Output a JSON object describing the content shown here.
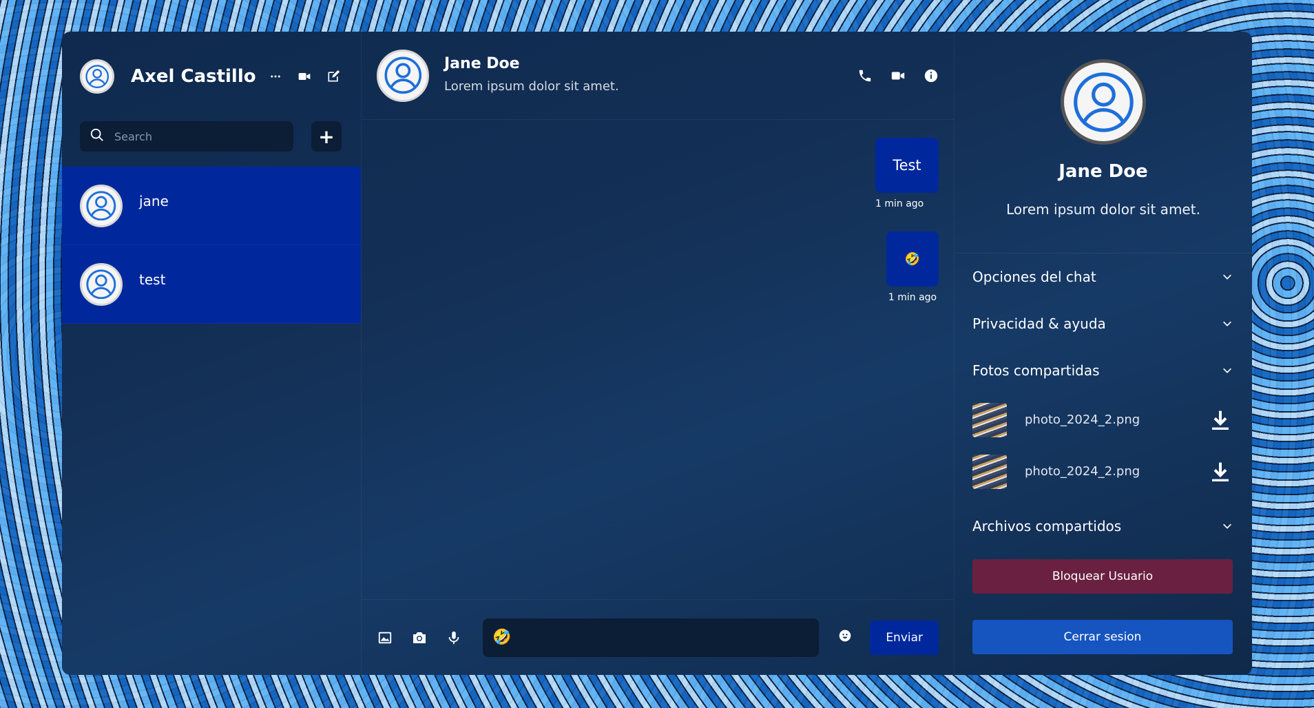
{
  "sidebar": {
    "user_name": "Axel Castillo",
    "icons": [
      "more-icon",
      "video-icon",
      "edit-icon"
    ],
    "search_placeholder": "Search",
    "add_label": "+",
    "contacts": [
      {
        "name": "jane"
      },
      {
        "name": "test"
      }
    ]
  },
  "chat": {
    "contact_name": "Jane Doe",
    "contact_status": "Lorem ipsum dolor sit amet.",
    "icons": [
      "phone-icon",
      "video-icon",
      "info-icon"
    ],
    "messages": [
      {
        "text": "Test",
        "time": "1 min ago"
      },
      {
        "text": "🤣",
        "time": "1 min ago"
      }
    ],
    "composer": {
      "input_value": "🤣",
      "send_label": "Enviar",
      "icons": [
        "image-icon",
        "camera-icon",
        "mic-icon",
        "emoji-icon"
      ]
    }
  },
  "details": {
    "name": "Jane Doe",
    "status": "Lorem ipsum dolor sit amet.",
    "sections": {
      "chat_options": "Opciones del chat",
      "privacy": "Privacidad & ayuda",
      "shared_photos": "Fotos compartidas",
      "shared_files": "Archivos compartidos"
    },
    "photos": [
      {
        "name": "photo_2024_2.png"
      },
      {
        "name": "photo_2024_2.png"
      }
    ],
    "block_label": "Bloquear Usuario",
    "logout_label": "Cerrar sesion"
  },
  "colors": {
    "accent": "#00289c",
    "block": "#6a2040",
    "logout": "#1655c0"
  }
}
